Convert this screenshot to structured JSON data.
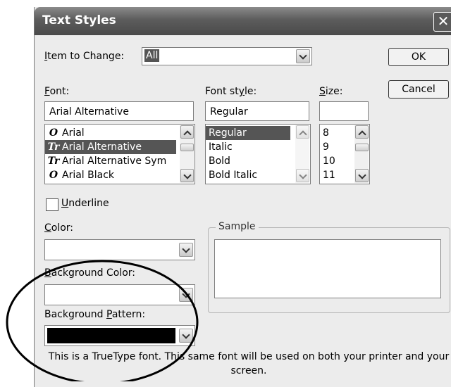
{
  "dialog": {
    "title": "Text Styles",
    "close_glyph": "✕",
    "item_to_change": {
      "label_pre": "",
      "label_u": "I",
      "label_post": "tem to Change:",
      "value": "All"
    },
    "buttons": {
      "ok": "OK",
      "cancel": "Cancel"
    },
    "font": {
      "label_u": "F",
      "label_post": "ont:",
      "value": "Arial Alternative",
      "items": [
        {
          "icon": "O",
          "label": "Arial",
          "selected": false
        },
        {
          "icon": "Tr",
          "label": "Arial Alternative",
          "selected": true
        },
        {
          "icon": "Tr",
          "label": "Arial Alternative Sym",
          "selected": false
        },
        {
          "icon": "O",
          "label": "Arial Black",
          "selected": false
        }
      ]
    },
    "font_style": {
      "label_pre": "Font st",
      "label_u": "y",
      "label_post": "le:",
      "value": "Regular",
      "items": [
        "Regular",
        "Italic",
        "Bold",
        "Bold Italic"
      ]
    },
    "size": {
      "label_u": "S",
      "label_post": "ize:",
      "value": "",
      "items": [
        "8",
        "9",
        "10",
        "11"
      ]
    },
    "underline": {
      "label_u": "U",
      "label_post": "nderline",
      "checked": false
    },
    "color": {
      "label_u": "C",
      "label_post": "olor:",
      "value": ""
    },
    "background_color": {
      "label_u": "B",
      "label_post": "ackground Color:",
      "value": ""
    },
    "background_pattern": {
      "label_pre": "Background ",
      "label_u": "P",
      "label_post": "attern:",
      "swatch_color": "#000000"
    },
    "sample": {
      "label": "Sample"
    },
    "info_text": "This is a TrueType font. This same font will be used on both your printer and your screen."
  }
}
